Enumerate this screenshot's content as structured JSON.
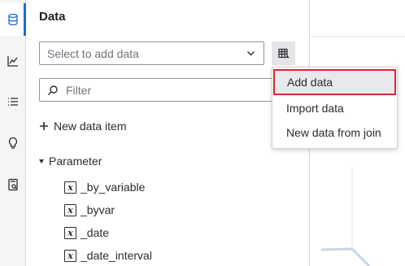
{
  "pane": {
    "title": "Data",
    "select_placeholder": "Select to add data",
    "filter_placeholder": "Filter",
    "new_data_item": "New data item",
    "parameter_header": "Parameter",
    "parameters": [
      "_by_variable",
      "_byvar",
      "_date",
      "_date_interval"
    ]
  },
  "menu": {
    "items": [
      "Add data",
      "Import data",
      "New data from join"
    ]
  },
  "rail": {
    "icons": [
      "database-icon",
      "line-chart-icon",
      "list-icon",
      "lightbulb-icon",
      "report-icon"
    ]
  },
  "colors": {
    "accent": "#1b6cd1",
    "highlight_border": "#d9272e"
  }
}
